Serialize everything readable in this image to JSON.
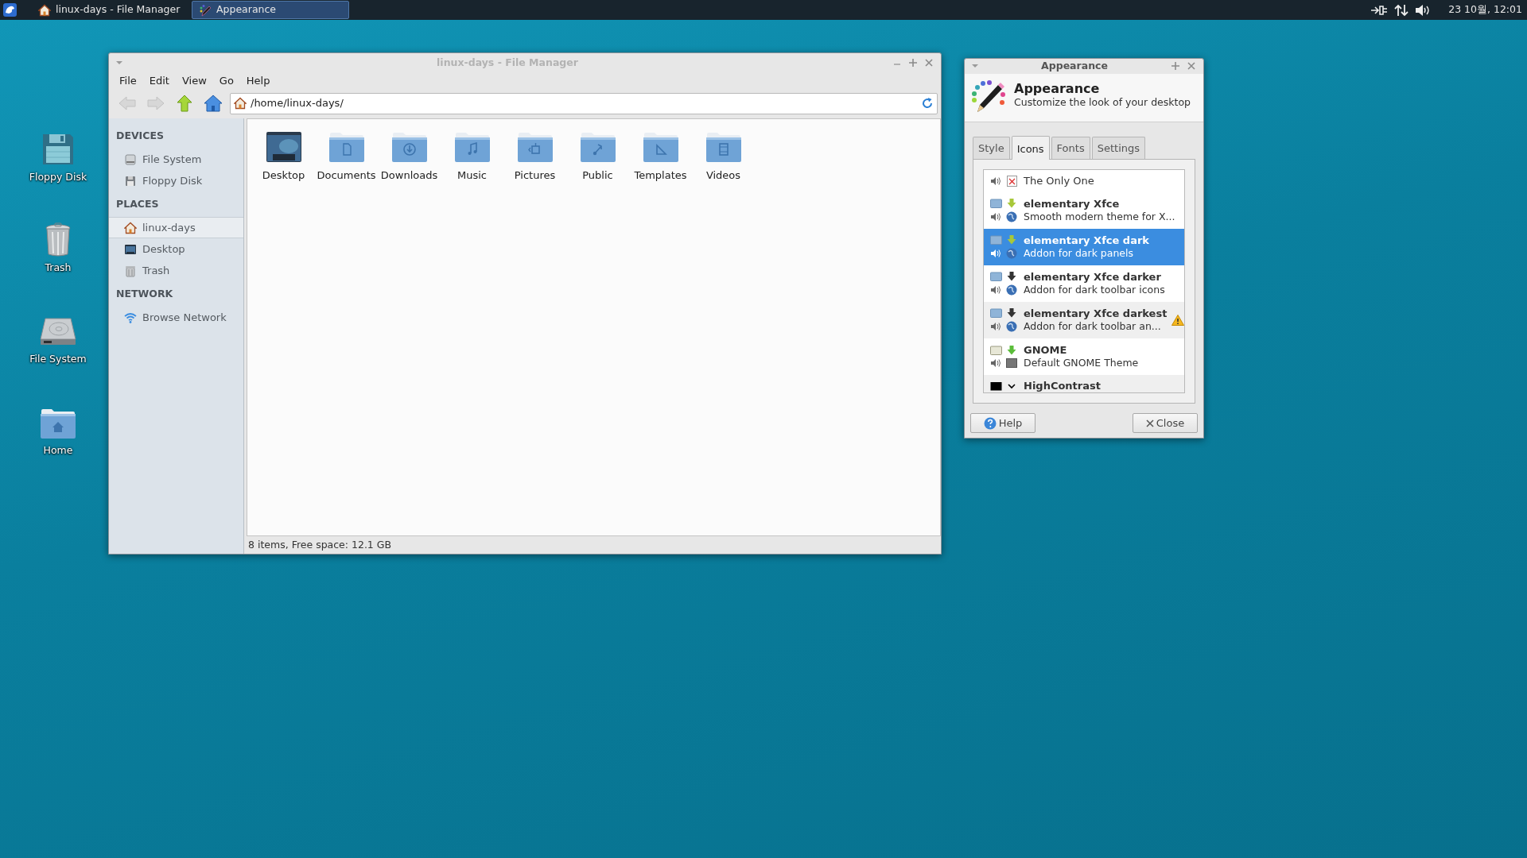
{
  "panel": {
    "tasks": [
      {
        "label": "linux-days - File Manager",
        "kind": "files",
        "selected": false
      },
      {
        "label": "Appearance",
        "kind": "appearance",
        "selected": true
      }
    ],
    "clock": "23 10월, 12:01"
  },
  "desktop_icons": [
    {
      "label": "Floppy Disk",
      "kind": "floppy"
    },
    {
      "label": "Trash",
      "kind": "trash"
    },
    {
      "label": "File System",
      "kind": "drive"
    },
    {
      "label": "Home",
      "kind": "home"
    }
  ],
  "file_manager": {
    "title": "linux-days - File Manager",
    "active": false,
    "menu": [
      "File",
      "Edit",
      "View",
      "Go",
      "Help"
    ],
    "nav_buttons": [
      {
        "kind": "back",
        "disabled": true
      },
      {
        "kind": "forward",
        "disabled": true
      },
      {
        "kind": "up",
        "disabled": false
      },
      {
        "kind": "home",
        "disabled": false
      }
    ],
    "location": "/home/linux-days/",
    "sidebar": [
      {
        "heading": "DEVICES",
        "items": [
          {
            "label": "File System",
            "kind": "drive",
            "selected": false
          },
          {
            "label": "Floppy Disk",
            "kind": "floppy",
            "selected": false
          }
        ]
      },
      {
        "heading": "PLACES",
        "items": [
          {
            "label": "linux-days",
            "kind": "home",
            "selected": true
          },
          {
            "label": "Desktop",
            "kind": "desktop",
            "selected": false
          },
          {
            "label": "Trash",
            "kind": "trash",
            "selected": false
          }
        ]
      },
      {
        "heading": "NETWORK",
        "items": [
          {
            "label": "Browse Network",
            "kind": "network",
            "selected": false
          }
        ]
      }
    ],
    "files": [
      {
        "label": "Desktop",
        "kind": "desktop"
      },
      {
        "label": "Documents",
        "kind": "documents"
      },
      {
        "label": "Downloads",
        "kind": "downloads"
      },
      {
        "label": "Music",
        "kind": "music"
      },
      {
        "label": "Pictures",
        "kind": "pictures"
      },
      {
        "label": "Public",
        "kind": "public"
      },
      {
        "label": "Templates",
        "kind": "templates"
      },
      {
        "label": "Videos",
        "kind": "videos"
      }
    ],
    "status": "8 items, Free space: 12.1 GB"
  },
  "appearance": {
    "title": "Appearance",
    "active": true,
    "heading": "Appearance",
    "subtitle": "Customize the look of your desktop",
    "tabs": [
      {
        "label": "Style",
        "selected": false
      },
      {
        "label": "Icons",
        "selected": true
      },
      {
        "label": "Fonts",
        "selected": false
      },
      {
        "label": "Settings",
        "selected": false
      }
    ],
    "themes": [
      {
        "name": "The Only One",
        "kind": "broken",
        "selected": false,
        "warning": false
      },
      {
        "name": "elementary Xfce",
        "description": "Smooth modern theme for X...",
        "kind": "main",
        "selected": false,
        "warning": false
      },
      {
        "name": "elementary Xfce dark",
        "description": "Addon for dark panels",
        "kind": "main",
        "selected": true,
        "warning": false
      },
      {
        "name": "elementary Xfce darker",
        "description": "Addon for dark toolbar icons",
        "kind": "addon",
        "selected": false,
        "warning": false
      },
      {
        "name": "elementary Xfce darkest",
        "description": "Addon for dark toolbar an...",
        "kind": "addon",
        "selected": false,
        "warning": true
      },
      {
        "name": "GNOME",
        "description": "Default GNOME Theme",
        "kind": "gnome",
        "selected": false,
        "warning": false
      },
      {
        "name": "HighContrast",
        "kind": "contrast",
        "selected": false,
        "warning": false
      }
    ],
    "buttons": [
      {
        "label": "Help",
        "kind": "help"
      },
      {
        "label": "Close",
        "kind": "close"
      }
    ]
  }
}
